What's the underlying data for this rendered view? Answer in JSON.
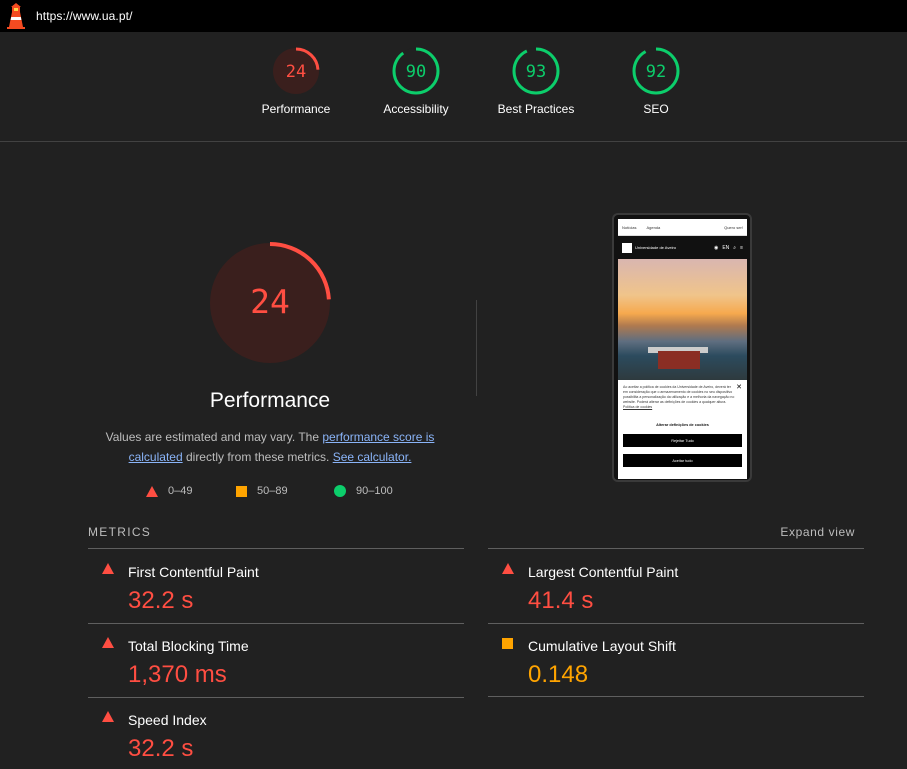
{
  "url": "https://www.ua.pt/",
  "colors": {
    "fail": "#ff4e42",
    "average": "#ffa400",
    "pass": "#0cce6b"
  },
  "summary": [
    {
      "label": "Performance",
      "score": "24",
      "value": 24,
      "status": "fail"
    },
    {
      "label": "Accessibility",
      "score": "90",
      "value": 90,
      "status": "pass"
    },
    {
      "label": "Best Practices",
      "score": "93",
      "value": 93,
      "status": "pass"
    },
    {
      "label": "SEO",
      "score": "92",
      "value": 92,
      "status": "pass"
    }
  ],
  "performance": {
    "score": "24",
    "value": 24,
    "title": "Performance",
    "desc_prefix": "Values are estimated and may vary. The ",
    "desc_link1": "performance score is calculated",
    "desc_middle": " directly from these metrics. ",
    "desc_link2": "See calculator."
  },
  "legend": [
    {
      "icon": "triangle",
      "range": "0–49"
    },
    {
      "icon": "square",
      "range": "50–89"
    },
    {
      "icon": "circle",
      "range": "90–100"
    }
  ],
  "screenshot": {
    "nav_left": [
      "Notícias",
      "Agenda"
    ],
    "nav_right": "Quero ser!",
    "logo_text": "Universidade de Aveiro",
    "lang": "EN",
    "cookie_text": "Ao aceitar a política de cookies da Universidade de Aveiro, deverá ter em consideração que o armazenamento de cookies no seu dispositivo possibilita a personalização da utilização e a melhoria da navegação no website. Poderá alterar as definições de cookies a qualquer altura.",
    "cookie_link": "Política de cookies",
    "alter_label": "Alterar definições de cookies",
    "reject_label": "Rejeitar Tudo",
    "accept_label": "Aceitar tudo"
  },
  "metrics_label": "METRICS",
  "expand_label": "Expand view",
  "metrics": [
    {
      "name": "First Contentful Paint",
      "value": "32.2 s",
      "status": "fail"
    },
    {
      "name": "Largest Contentful Paint",
      "value": "41.4 s",
      "status": "fail"
    },
    {
      "name": "Total Blocking Time",
      "value": "1,370 ms",
      "status": "fail"
    },
    {
      "name": "Cumulative Layout Shift",
      "value": "0.148",
      "status": "average"
    },
    {
      "name": "Speed Index",
      "value": "32.2 s",
      "status": "fail"
    }
  ]
}
